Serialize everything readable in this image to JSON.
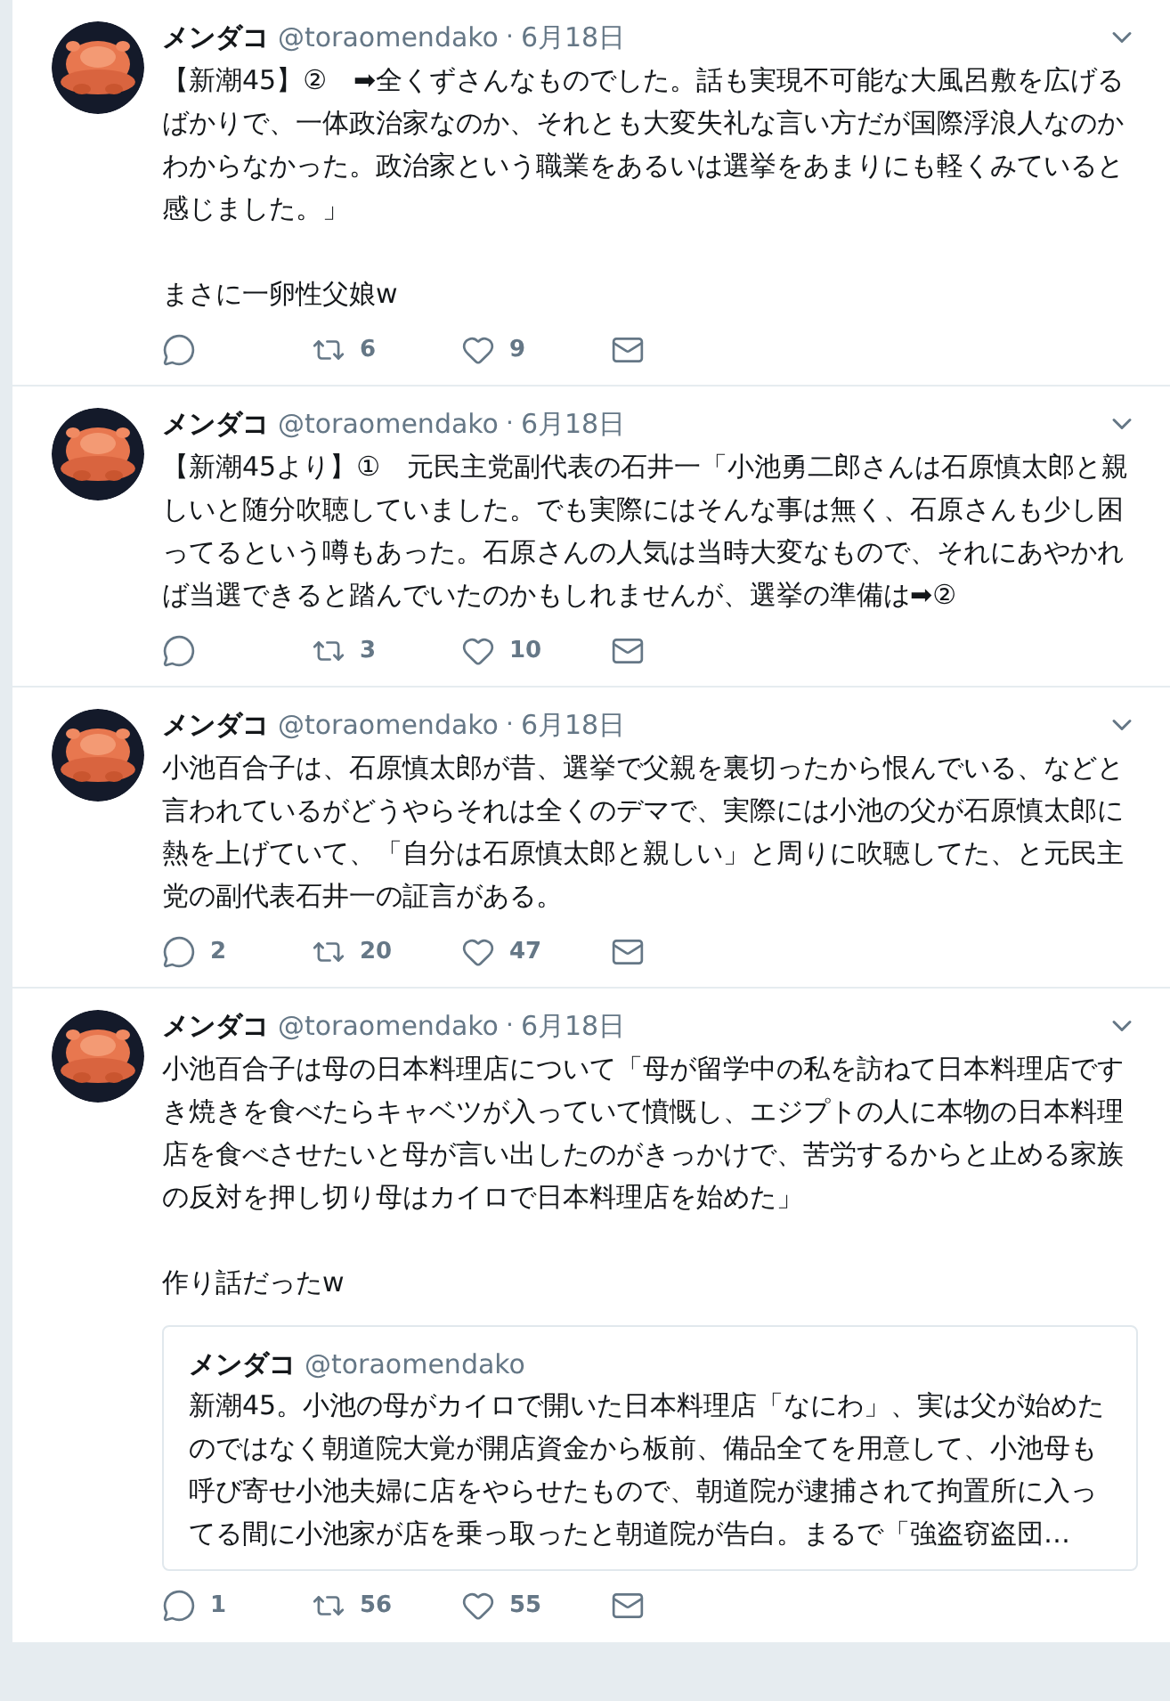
{
  "tweets": [
    {
      "name": "メンダコ",
      "handle": "@toraomendako",
      "separator": "·",
      "date": "6月18日",
      "paragraphs": [
        "【新潮45】②　➡全くずさんなものでした。話も実現不可能な大風呂敷を広げるばかりで、一体政治家なのか、それとも大変失礼な言い方だが国際浮浪人なのかわからなかった。政治家という職業をあるいは選挙をあまりにも軽くみていると感じました。」",
        "まさに一卵性父娘w"
      ],
      "retweets": "6",
      "likes": "9"
    },
    {
      "name": "メンダコ",
      "handle": "@toraomendako",
      "separator": "·",
      "date": "6月18日",
      "paragraphs": [
        "【新潮45より】①　元民主党副代表の石井一「小池勇二郎さんは石原慎太郎と親しいと随分吹聴していました。でも実際にはそんな事は無く、石原さんも少し困ってるという噂もあった。石原さんの人気は当時大変なもので、それにあやかれば当選できると踏んでいたのかもしれませんが、選挙の準備は➡②"
      ],
      "retweets": "3",
      "likes": "10"
    },
    {
      "name": "メンダコ",
      "handle": "@toraomendako",
      "separator": "·",
      "date": "6月18日",
      "paragraphs": [
        "小池百合子は、石原慎太郎が昔、選挙で父親を裏切ったから恨んでいる、などと言われているがどうやらそれは全くのデマで、実際には小池の父が石原慎太郎に熱を上げていて、「自分は石原慎太郎と親しい」と周りに吹聴してた、と元民主党の副代表石井一の証言がある。"
      ],
      "replies": "2",
      "retweets": "20",
      "likes": "47"
    },
    {
      "name": "メンダコ",
      "handle": "@toraomendako",
      "separator": "·",
      "date": "6月18日",
      "paragraphs": [
        "小池百合子は母の日本料理店について「母が留学中の私を訪ねて日本料理店ですき焼きを食べたらキャベツが入っていて憤慨し、エジプトの人に本物の日本料理店を食べさせたいと母が言い出したのがきっかけで、苦労するからと止める家族の反対を押し切り母はカイロで日本料理店を始めた」",
        "作り話だったw"
      ],
      "quote": {
        "name": "メンダコ",
        "handle": "@toraomendako",
        "text": "新潮45。小池の母がカイロで開いた日本料理店「なにわ」、実は父が始めたのではなく朝道院大覚が開店資金から板前、備品全てを用意して、小池母も呼び寄せ小池夫婦に店をやらせたもので、朝道院が逮捕されて拘置所に入ってる間に小池家が店を乗っ取ったと朝道院が告白。まるで「強盗窃盗団…"
      },
      "replies": "1",
      "retweets": "56",
      "likes": "55"
    }
  ]
}
